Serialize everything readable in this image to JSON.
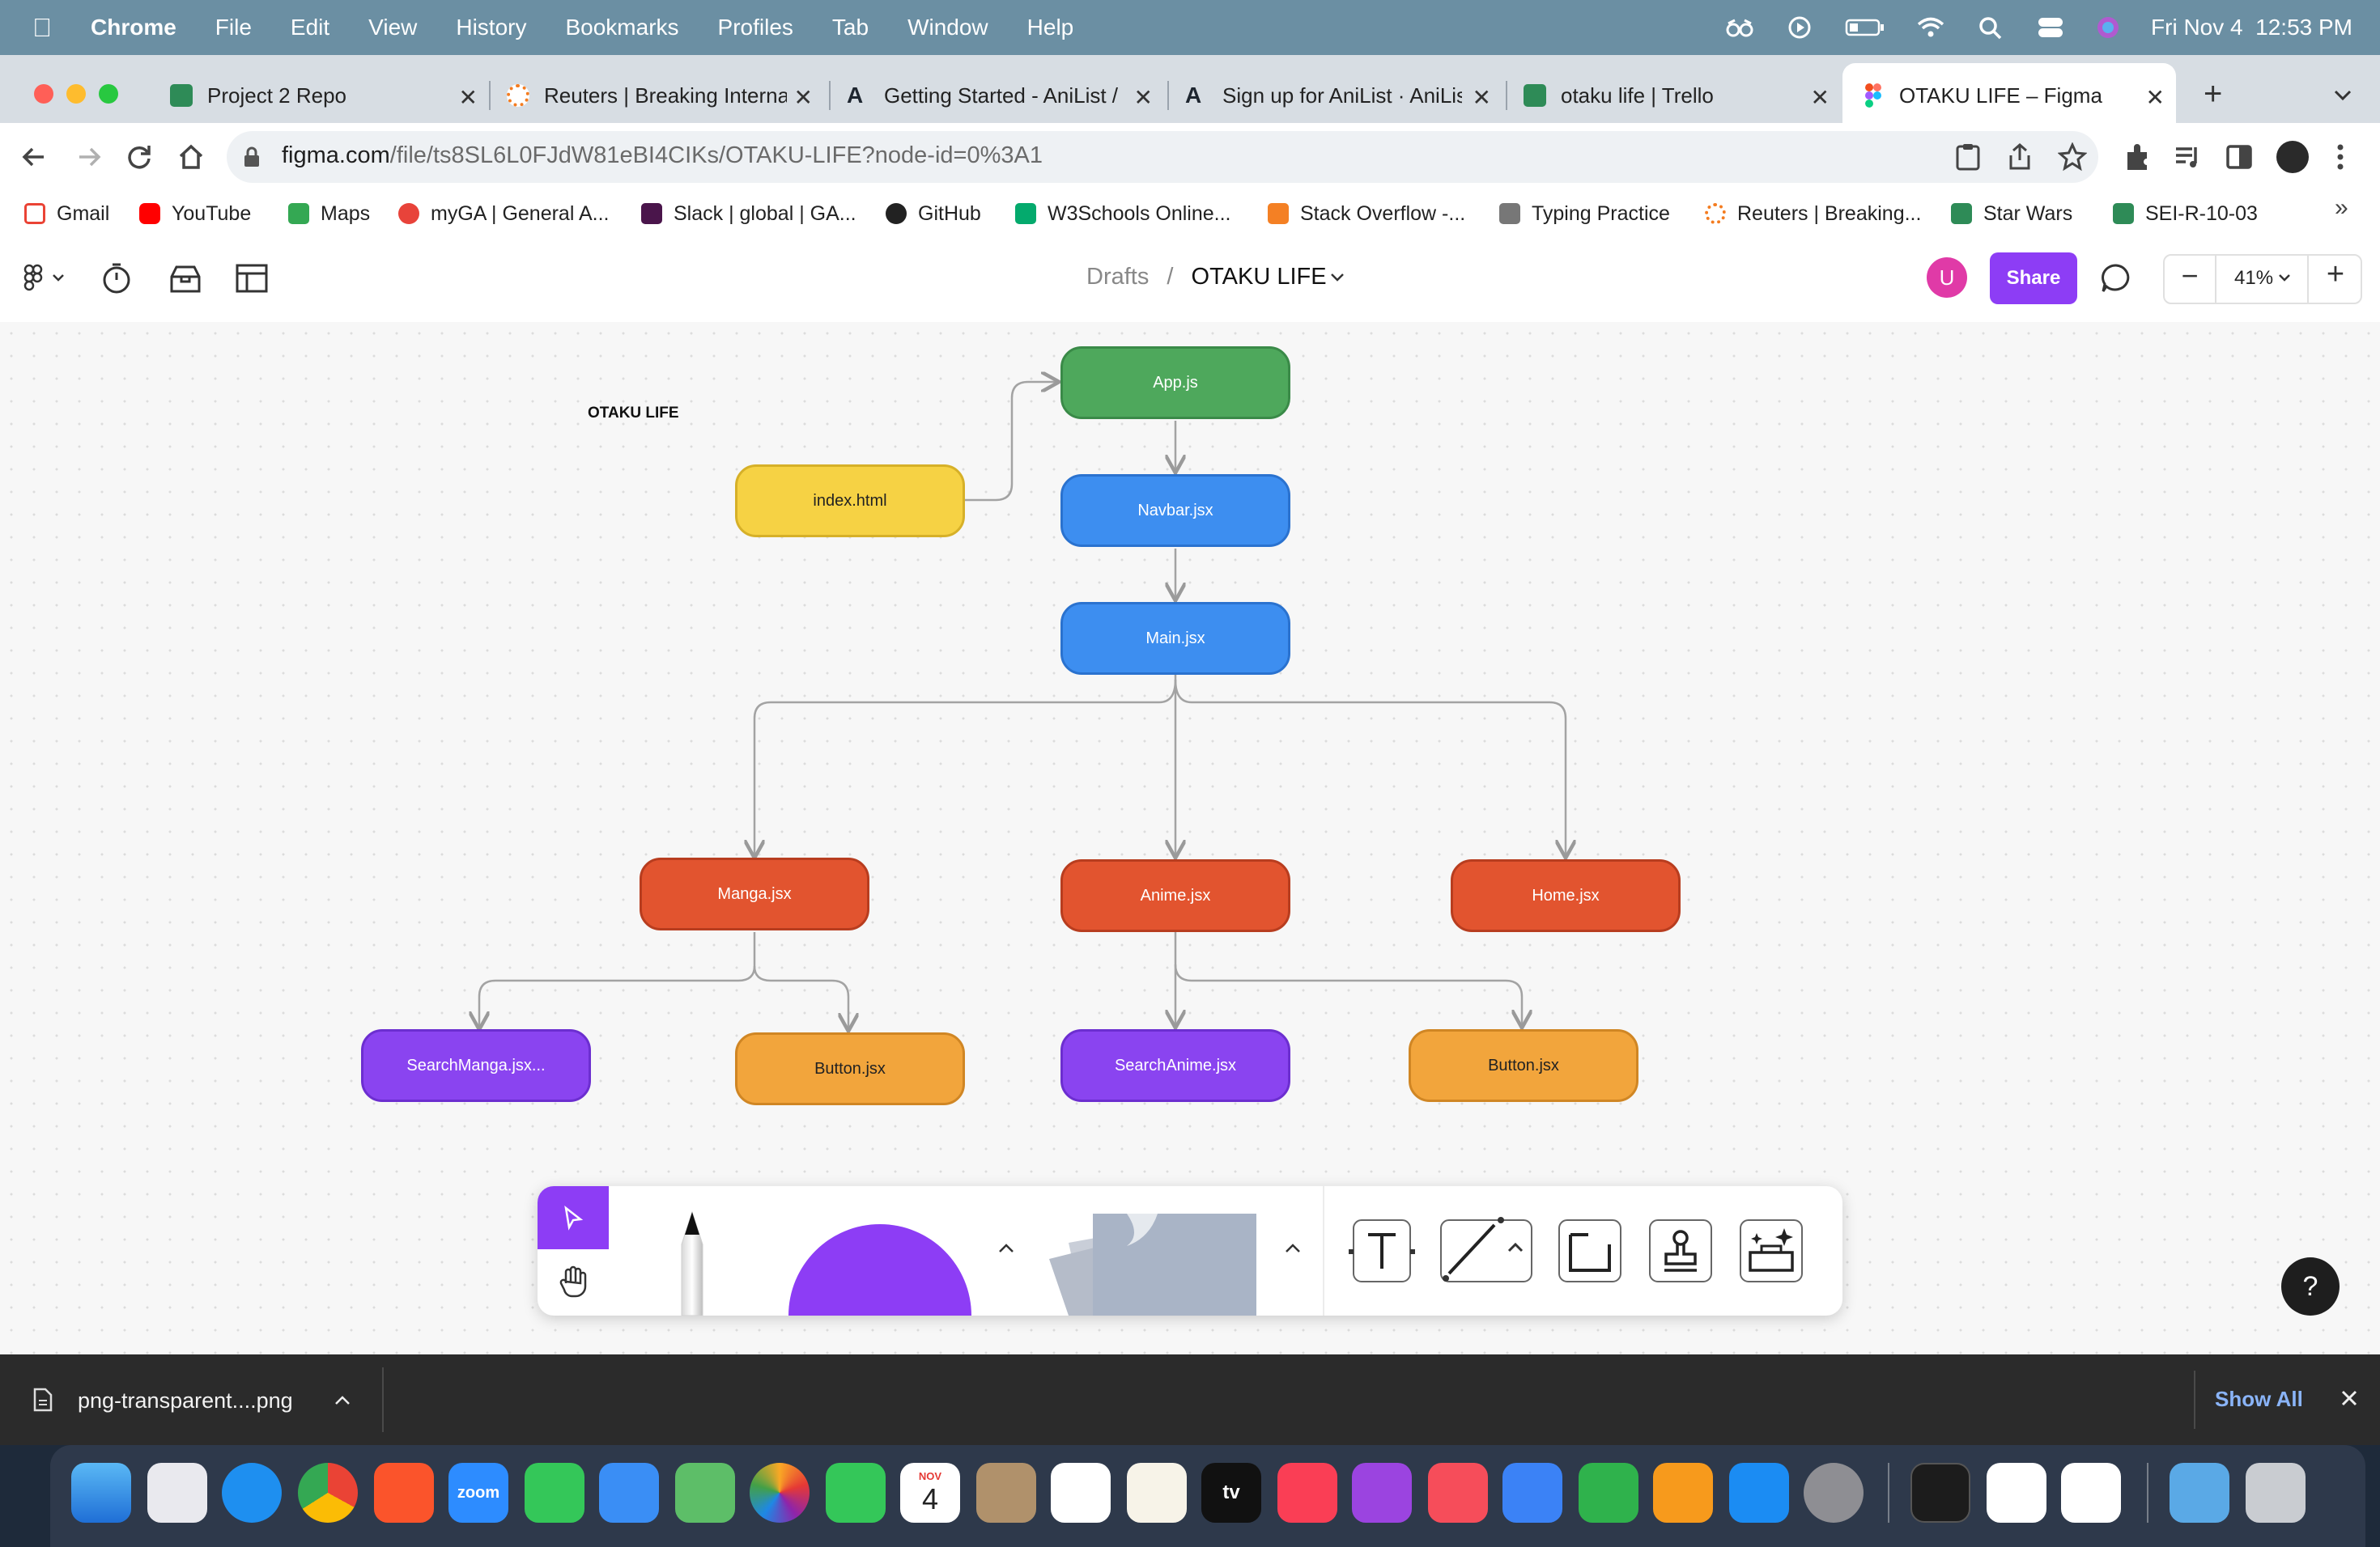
{
  "menubar": {
    "app": "Chrome",
    "items": [
      "File",
      "Edit",
      "View",
      "History",
      "Bookmarks",
      "Profiles",
      "Tab",
      "Window",
      "Help"
    ],
    "datetime": "Fri Nov 4  12:53 PM"
  },
  "tabs": [
    {
      "title": "Project 2 Repo",
      "icon": "person-icon",
      "color": "#2e8b57"
    },
    {
      "title": "Reuters | Breaking Interna",
      "icon": "reuters-icon",
      "color": "#f47c20"
    },
    {
      "title": "Getting Started - AniList /",
      "icon": "anilist-icon",
      "color": "#1e2630"
    },
    {
      "title": "Sign up for AniList · AniLis",
      "icon": "anilist-icon",
      "color": "#1e2630"
    },
    {
      "title": "otaku life | Trello",
      "icon": "trello-icon",
      "color": "#2e8b57"
    },
    {
      "title": "OTAKU LIFE – Figma",
      "icon": "figma-icon",
      "color": "#f24e1e",
      "active": true
    }
  ],
  "address": {
    "host": "figma.com",
    "path": "/file/ts8SL6L0FJdW81eBI4CIKs/OTAKU-LIFE?node-id=0%3A1"
  },
  "bookmarks": [
    {
      "label": "Gmail",
      "color": "#ea4335"
    },
    {
      "label": "YouTube",
      "color": "#ff0000"
    },
    {
      "label": "Maps",
      "color": "#34a853"
    },
    {
      "label": "myGA | General A...",
      "color": "#e8433a"
    },
    {
      "label": "Slack | global | GA...",
      "color": "#4a154b"
    },
    {
      "label": "GitHub",
      "color": "#222222"
    },
    {
      "label": "W3Schools Online...",
      "color": "#04aa6d"
    },
    {
      "label": "Stack Overflow -...",
      "color": "#f48024"
    },
    {
      "label": "Typing Practice",
      "color": "#777777"
    },
    {
      "label": "Reuters | Breaking...",
      "color": "#f47c20"
    },
    {
      "label": "Star Wars",
      "color": "#2e8b57"
    },
    {
      "label": "SEI-R-10-03",
      "color": "#2e8b57"
    }
  ],
  "figma": {
    "breadcrumb_parent": "Drafts",
    "breadcrumb_sep": "/",
    "file_name": "OTAKU LIFE",
    "avatar_letter": "U",
    "share_label": "Share",
    "zoom": "41%",
    "zoom_minus": "−",
    "zoom_plus": "+",
    "help": "?"
  },
  "diagram": {
    "title": "OTAKU LIFE",
    "nodes": {
      "app": "App.js",
      "index": "index.html",
      "navbar": "Navbar.jsx",
      "main": "Main.jsx",
      "manga": "Manga.jsx",
      "anime": "Anime.jsx",
      "home": "Home.jsx",
      "search_manga": "SearchManga.jsx...",
      "button_manga": "Button.jsx",
      "search_anime": "SearchAnime.jsx",
      "button_anime": "Button.jsx"
    },
    "colors": {
      "green": "#4ea85c",
      "blue": "#3d8ef0",
      "yellow": "#f6d244",
      "red": "#e2542f",
      "purple": "#8a44f0",
      "orange": "#f2a53c"
    }
  },
  "downloads": {
    "file": "png-transparent....png",
    "show_all": "Show All"
  },
  "dock": {
    "zoom": "zoom",
    "calendar_month": "NOV",
    "calendar_day": "4",
    "tv": "tv"
  }
}
